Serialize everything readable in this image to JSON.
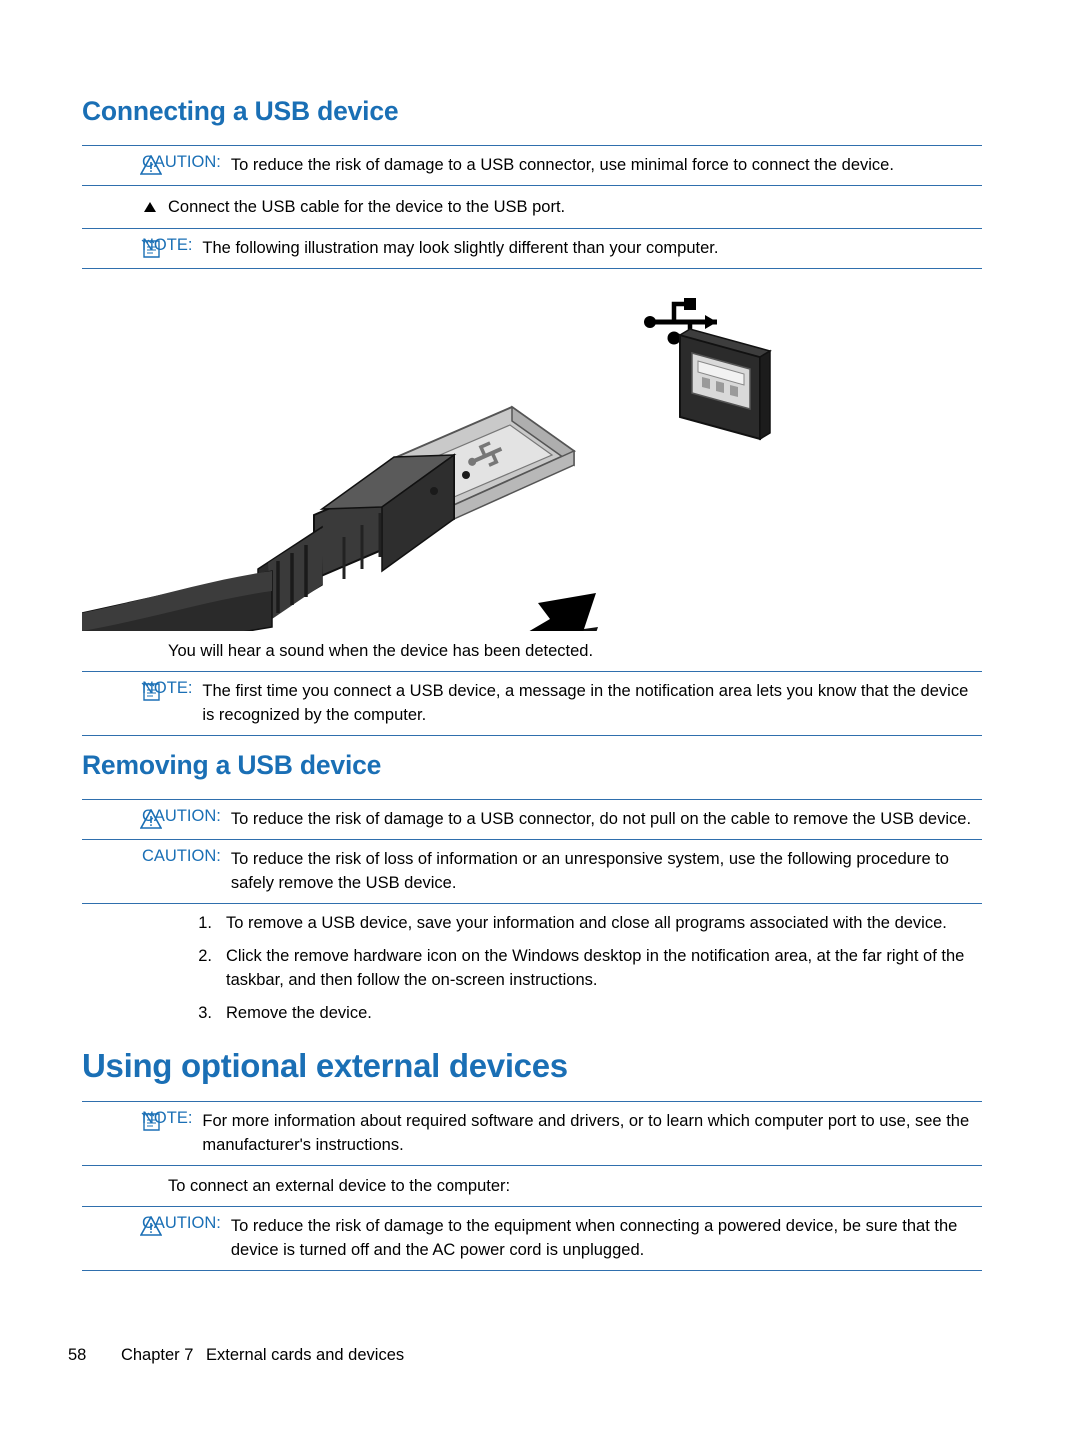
{
  "document": {
    "headings": {
      "connecting": "Connecting a USB device",
      "removing": "Removing a USB device",
      "using_optional": "Using optional external devices"
    },
    "labels": {
      "caution": "CAUTION:",
      "note": "NOTE:"
    },
    "blocks": {
      "caution_connect": "To reduce the risk of damage to a USB connector, use minimal force to connect the device.",
      "bullet_connect": "Connect the USB cable for the device to the USB port.",
      "note_illustration": "The following illustration may look slightly different than your computer.",
      "sound_detected": "You will hear a sound when the device has been detected.",
      "note_first_time": "The first time you connect a USB device, a message in the notification area lets you know that the device is recognized by the computer.",
      "caution_remove_cable": "To reduce the risk of damage to a USB connector, do not pull on the cable to remove the USB device.",
      "caution_loss_info": "To reduce the risk of loss of information or an unresponsive system, use the following procedure to safely remove the USB device.",
      "note_more_info": "For more information about required software and drivers, or to learn which computer port to use, see the manufacturer's instructions.",
      "connect_external": "To connect an external device to the computer:",
      "caution_powered_device": "To reduce the risk of damage to the equipment when connecting a powered device, be sure that the device is turned off and the AC power cord is unplugged."
    },
    "steps": [
      {
        "number": "1.",
        "text": "To remove a USB device, save your information and close all programs associated with the device."
      },
      {
        "number": "2.",
        "text": "Click the remove hardware icon on the Windows desktop in the notification area, at the far right of the taskbar, and then follow the on-screen instructions."
      },
      {
        "number": "3.",
        "text": "Remove the device."
      }
    ],
    "figure": {
      "alt_name": "usb-cable-connector-illustration",
      "usb_symbol": "usb-trident-icon"
    },
    "footer": {
      "page_number": "58",
      "chapter": "Chapter 7",
      "chapter_title": "External cards and devices"
    },
    "colors": {
      "heading_blue": "#1a6fb5",
      "rule_blue": "#2f6fad",
      "text_black": "#000000"
    }
  }
}
